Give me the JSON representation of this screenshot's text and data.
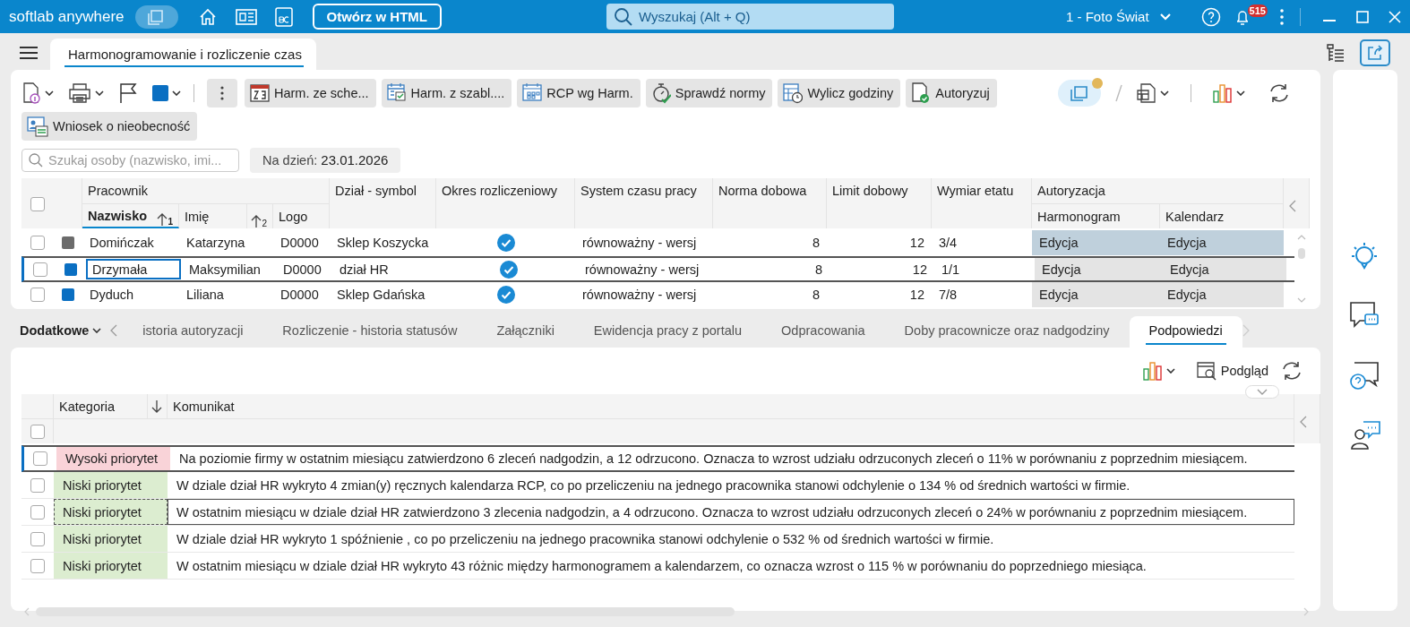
{
  "app_bar": {
    "brand": "softlab anywhere",
    "open_button": "Otwórz w HTML",
    "search": {
      "placeholder": "Wyszukaj (Alt + Q)"
    },
    "company": "1 - Foto Świat",
    "notifications": "515",
    "toggle_on": true
  },
  "tabs": [
    {
      "label": "Harmonogramowanie i rozliczenie czas",
      "selected": true
    }
  ],
  "toolbar": {
    "actions": [
      "Harm. ze sche...",
      "Harm. z szabl....",
      "RCP wg Harm.",
      "Sprawdź normy",
      "Wylicz godziny",
      "Autoryzuj"
    ],
    "second_row": [
      "Wniosek o nieobecność"
    ],
    "toggle_on": true
  },
  "person_search": {
    "placeholder": "Szukaj osoby (nazwisko, imi..."
  },
  "date": "Na dzień: **23.01.2026**",
  "employee_table": {
    "groups": [
      "Pracownik",
      "Autoryzacja"
    ],
    "all_checked": false,
    "columns": [
      {
        "label": "Nazwisko",
        "sort_rank": "1",
        "active": true
      },
      {
        "label": "Imię",
        "sort_rank": "2",
        "active": false
      },
      {
        "label": "Logo"
      },
      {
        "label": "Dział - symbol"
      },
      {
        "label": "Okres rozliczeniowy"
      },
      {
        "label": "System czasu pracy"
      },
      {
        "label": "Norma dobowa"
      },
      {
        "label": "Limit dobowy"
      },
      {
        "label": "Wymiar etatu"
      },
      {
        "label": "Harmonogram"
      },
      {
        "label": "Kalendarz"
      }
    ],
    "rows": [
      {
        "checked": false,
        "selected": false,
        "highlighted": true,
        "color": "#6b6b6b",
        "last_name": "Domińczak",
        "first_name": "Katarzyna",
        "logo": "D0000",
        "department": "Sklep Koszycka",
        "settled": true,
        "work_time_system": "równoważny - wersj",
        "daily_norm": "8",
        "daily_limit": "12",
        "fte": "3/4",
        "schedule_auth": "Edycja",
        "calendar_auth": "Edycja"
      },
      {
        "checked": false,
        "selected": true,
        "highlighted": false,
        "color": "#0a6fc2",
        "last_name": "Drzymała",
        "first_name": "Maksymilian",
        "logo": "D0000",
        "department": "dział HR",
        "settled": true,
        "work_time_system": "równoważny - wersj",
        "daily_norm": "8",
        "daily_limit": "12",
        "fte": "1/1",
        "schedule_auth": "Edycja",
        "calendar_auth": "Edycja"
      },
      {
        "checked": false,
        "selected": false,
        "highlighted": false,
        "color": "#0a6fc2",
        "last_name": "Dyduch",
        "first_name": "Liliana",
        "logo": "D0000",
        "department": "Sklep Gdańska",
        "settled": true,
        "work_time_system": "równoważny - wersj",
        "daily_norm": "8",
        "daily_limit": "12",
        "fte": "7/8",
        "schedule_auth": "Edycja",
        "calendar_auth": "Edycja"
      }
    ]
  },
  "detail_tabs": {
    "menu": "Dodatkowe",
    "tabs": [
      {
        "label": "istoria autoryzacji",
        "selected": false
      },
      {
        "label": "Rozliczenie - historia statusów",
        "selected": false
      },
      {
        "label": "Załączniki",
        "selected": false
      },
      {
        "label": "Ewidencja pracy z portalu",
        "selected": false
      },
      {
        "label": "Odpracowania",
        "selected": false
      },
      {
        "label": "Doby pracownicze oraz nadgodziny",
        "selected": false
      },
      {
        "label": "Podpowiedzi",
        "selected": true
      }
    ]
  },
  "hints": {
    "preview_button": "Podgląd",
    "all_checked": false,
    "columns": [
      {
        "label": "Kategoria"
      },
      {
        "label": "Komunikat"
      }
    ],
    "rows": [
      {
        "checked": false,
        "selected": true,
        "focused": false,
        "category": "Wysoki priorytet",
        "color": "#f9d3d8",
        "message": "Na poziomie firmy w ostatnim miesiącu zatwierdzono 6 zleceń  nadgodzin, a 12 odrzucono. Oznacza to wzrost udziału odrzuconych zleceń o 11% w porównaniu z poprzednim miesiącem."
      },
      {
        "checked": false,
        "selected": false,
        "focused": false,
        "category": "Niski priorytet",
        "color": "#dcedd0",
        "message": "W dziale dział HR wykryto 4 zmian(y) ręcznych kalendarza RCP, co po przeliczeniu na jednego pracownika stanowi odchylenie o 134 % od średnich wartości w firmie."
      },
      {
        "checked": false,
        "selected": false,
        "focused": true,
        "category": "Niski priorytet",
        "color": "#dcedd0",
        "message": "W ostatnim miesiącu w dziale dział HR zatwierdzono 3 zlecenia nadgodzin, a 4 odrzucono. Oznacza to wzrost udziału odrzuconych zleceń o 24% w porównaniu z poprzednim miesiącem."
      },
      {
        "checked": false,
        "selected": false,
        "focused": false,
        "category": "Niski priorytet",
        "color": "#dcedd0",
        "message": "W dziale dział HR wykryto 1 spóźnienie , co po przeliczeniu na jednego pracownika stanowi odchylenie o 532 % od średnich wartości w firmie."
      },
      {
        "checked": false,
        "selected": false,
        "focused": false,
        "category": "Niski priorytet",
        "color": "#dcedd0",
        "message": "W ostatnim miesiącu w dziale dział HR wykryto 43 różnic  między harmonogramem a kalendarzem, co oznacza wzrost o 115 % w porównaniu do poprzedniego miesiąca."
      }
    ]
  }
}
